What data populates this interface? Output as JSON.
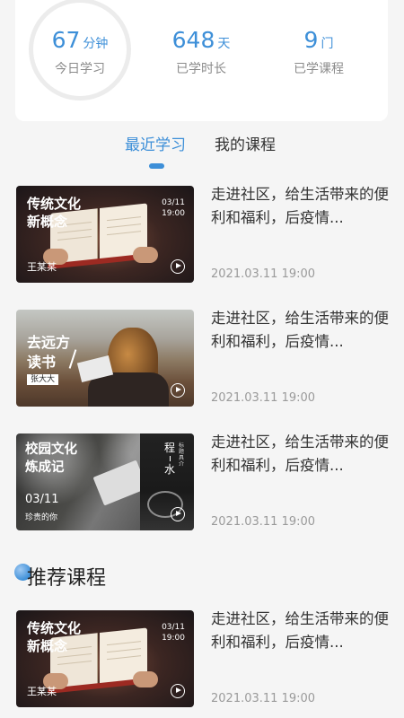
{
  "stats": {
    "today": {
      "value": "67",
      "unit": "分钟",
      "label": "今日学习"
    },
    "days": {
      "value": "648",
      "unit": "天",
      "label": "已学时长"
    },
    "courses": {
      "value": "9",
      "unit": "门",
      "label": "已学课程"
    }
  },
  "tabs": [
    {
      "label": "最近学习",
      "active": true
    },
    {
      "label": "我的课程",
      "active": false
    }
  ],
  "recent": [
    {
      "title": "走进社区，给生活带来的便利和福利，后疫情...",
      "date": "2021.03.11 19:00",
      "thumb": {
        "title_line1": "传统文化",
        "title_line2": "新概念",
        "date_line1": "03/11",
        "date_line2": "19:00",
        "name": "王某某"
      }
    },
    {
      "title": "走进社区，给生活带来的便利和福利，后疫情...",
      "date": "2021.03.11 19:00",
      "thumb": {
        "title_line1": "去远方",
        "title_line2": "读书",
        "tag": "张大大"
      }
    },
    {
      "title": "走进社区，给生活带来的便利和福利，后疫情...",
      "date": "2021.03.11 19:00",
      "thumb": {
        "title_line1": "校园文化",
        "title_line2": "炼成记",
        "side_line1": "程",
        "side_line2": "水",
        "side_small": "标题具介",
        "date": "03/11",
        "caption": "珍贵的你"
      }
    }
  ],
  "recommend": {
    "header": "推荐课程",
    "items": [
      {
        "title": "走进社区，给生活带来的便利和福利，后疫情...",
        "date": "2021.03.11 19:00",
        "thumb": {
          "title_line1": "传统文化",
          "title_line2": "新概念",
          "date_line1": "03/11",
          "date_line2": "19:00",
          "name": "王某某"
        }
      }
    ]
  },
  "colors": {
    "accent": "#3d8fd8",
    "background": "#f5f5f5",
    "card": "#ffffff"
  }
}
